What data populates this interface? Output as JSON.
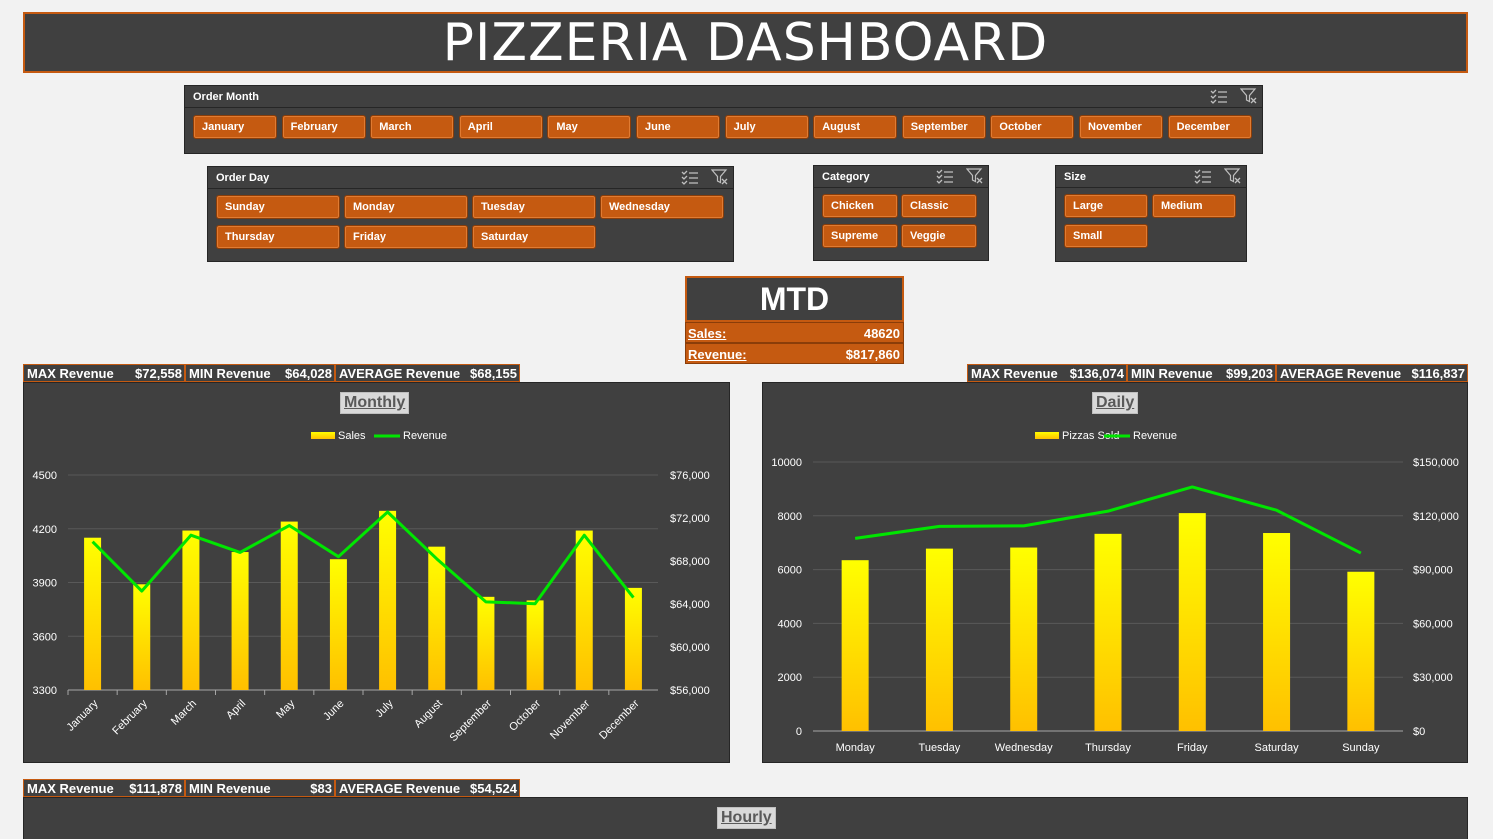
{
  "title": "PIZZERIA DASHBOARD",
  "slicers": {
    "order_month": {
      "label": "Order Month",
      "items": [
        "January",
        "February",
        "March",
        "April",
        "May",
        "June",
        "July",
        "August",
        "September",
        "October",
        "November",
        "December"
      ]
    },
    "order_day": {
      "label": "Order Day",
      "items": [
        "Sunday",
        "Monday",
        "Tuesday",
        "Wednesday",
        "Thursday",
        "Friday",
        "Saturday"
      ]
    },
    "category": {
      "label": "Category",
      "items": [
        "Chicken",
        "Classic",
        "Supreme",
        "Veggie"
      ]
    },
    "size": {
      "label": "Size",
      "items": [
        "Large",
        "Medium",
        "Small"
      ]
    },
    "icons": [
      "multi-select-icon",
      "clear-filter-icon"
    ]
  },
  "mtd": {
    "title": "MTD",
    "sales_label": "Sales:",
    "sales_value": "48620",
    "revenue_label": "Revenue:",
    "revenue_value": "$817,860"
  },
  "stats_monthly": {
    "max_label": "MAX Revenue",
    "max_value": "$72,558",
    "min_label": "MIN Revenue",
    "min_value": "$64,028",
    "avg_label": "AVERAGE Revenue",
    "avg_value": "$68,155"
  },
  "stats_daily": {
    "max_label": "MAX Revenue",
    "max_value": "$136,074",
    "min_label": "MIN Revenue",
    "min_value": "$99,203",
    "avg_label": "AVERAGE Revenue",
    "avg_value": "$116,837"
  },
  "stats_hourly": {
    "max_label": "MAX Revenue",
    "max_value": "$111,878",
    "min_label": "MIN Revenue",
    "min_value": "$83",
    "avg_label": "AVERAGE Revenue",
    "avg_value": "$54,524"
  },
  "hourly": {
    "title": "Hourly"
  },
  "colors": {
    "accent": "#c55a11",
    "panel": "#404040",
    "bar_top": "#ffff00",
    "bar_bottom": "#ffc000",
    "line": "#00e600"
  },
  "chart_data": [
    {
      "type": "bar",
      "title": "Monthly",
      "categories": [
        "January",
        "February",
        "March",
        "April",
        "May",
        "June",
        "July",
        "August",
        "September",
        "October",
        "November",
        "December"
      ],
      "series": [
        {
          "name": "Sales",
          "type": "bar",
          "axis": "left",
          "values": [
            4150,
            3890,
            4190,
            4070,
            4240,
            4030,
            4300,
            4100,
            3820,
            3800,
            4190,
            3870
          ]
        },
        {
          "name": "Revenue",
          "type": "line",
          "axis": "right",
          "values": [
            69800,
            65200,
            70400,
            68800,
            71300,
            68400,
            72558,
            68200,
            64200,
            64028,
            70400,
            64600
          ]
        }
      ],
      "ylim_left": [
        3300,
        4500
      ],
      "yticks_left": [
        "3300",
        "3600",
        "3900",
        "4200",
        "4500"
      ],
      "ylim_right": [
        56000,
        76000
      ],
      "yticks_right": [
        "$56,000",
        "$60,000",
        "$64,000",
        "$68,000",
        "$72,000",
        "$76,000"
      ],
      "legend": "top"
    },
    {
      "type": "bar",
      "title": "Daily",
      "categories": [
        "Monday",
        "Tuesday",
        "Wednesday",
        "Thursday",
        "Friday",
        "Saturday",
        "Sunday"
      ],
      "series": [
        {
          "name": "Pizzas Sold",
          "type": "bar",
          "axis": "left",
          "values": [
            6350,
            6780,
            6820,
            7330,
            8100,
            7360,
            5920
          ]
        },
        {
          "name": "Revenue",
          "type": "line",
          "axis": "right",
          "values": [
            107400,
            114100,
            114400,
            122600,
            136074,
            123100,
            99203
          ]
        }
      ],
      "ylim_left": [
        0,
        10000
      ],
      "yticks_left": [
        "0",
        "2000",
        "4000",
        "6000",
        "8000",
        "10000"
      ],
      "ylim_right": [
        0,
        150000
      ],
      "yticks_right": [
        "$0",
        "$30,000",
        "$60,000",
        "$90,000",
        "$120,000",
        "$150,000"
      ],
      "legend": "top"
    }
  ]
}
